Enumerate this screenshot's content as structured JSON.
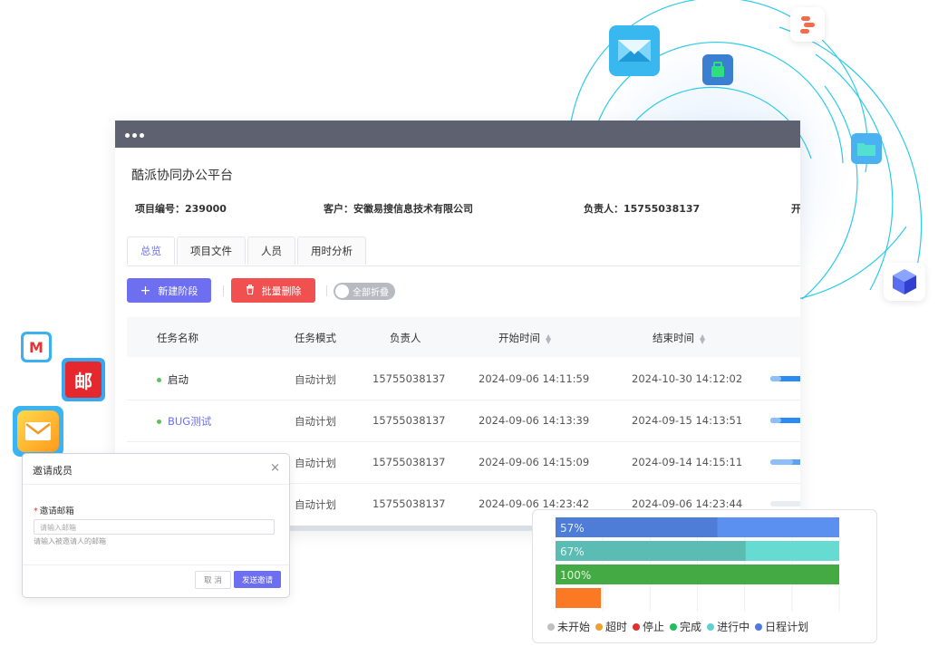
{
  "window": {
    "app_title": "酷派协同办公平台",
    "project_no": "项目编号：239000",
    "client": "客户：安徽易搜信息技术有限公司",
    "owner": "负责人：15755038137",
    "cut_label": "开"
  },
  "tabs": [
    {
      "label": "总览",
      "active": true
    },
    {
      "label": "项目文件",
      "active": false
    },
    {
      "label": "人员",
      "active": false
    },
    {
      "label": "用时分析",
      "active": false
    }
  ],
  "toolbar": {
    "add_stage": "新建阶段",
    "batch_delete": "批量删除",
    "collapse_all": "全部折叠"
  },
  "table": {
    "columns": [
      "任务名称",
      "任务模式",
      "负责人",
      "开始时间",
      "结束时间"
    ],
    "rows": [
      {
        "name": "启动",
        "mode": "自动计划",
        "owner": "15755038137",
        "start": "2024-09-06 14:11:59",
        "end": "2024-10-30 14:12:02"
      },
      {
        "name": "BUG测试",
        "mode": "自动计划",
        "owner": "15755038137",
        "start": "2024-09-06 14:13:39",
        "end": "2024-09-15 14:13:51"
      },
      {
        "name": "",
        "mode": "自动计划",
        "owner": "15755038137",
        "start": "2024-09-06 14:15:09",
        "end": "2024-09-14 14:15:11"
      },
      {
        "name": "",
        "mode": "自动计划",
        "owner": "15755038137",
        "start": "2024-09-06 14:23:42",
        "end": "2024-09-06 14:23:44"
      }
    ]
  },
  "dialog": {
    "title": "邀请成员",
    "close": "×",
    "field_label": "邀请邮箱",
    "required_mark": "*",
    "placeholder": "请输入邮箱",
    "hint": "请输入被邀请人的邮箱",
    "cancel": "取 消",
    "send": "发送邀请"
  },
  "chart_data": {
    "type": "bar",
    "orientation": "horizontal",
    "bars": [
      {
        "label": "57%",
        "progress": 0.57,
        "fill_color": "#4d7dd6",
        "track_color": "#5b8ff0"
      },
      {
        "label": "67%",
        "progress": 0.67,
        "fill_color": "#5bbcb3",
        "track_color": "#66dbd2"
      },
      {
        "label": "100%",
        "progress": 1.0,
        "fill_color": "#44ab44",
        "track_color": "#44ab44"
      },
      {
        "label": "",
        "progress": 0.16,
        "fill_color": "#fb7825",
        "track_color": "none"
      }
    ],
    "legend": [
      {
        "label": "未开始",
        "color": "#c0c0c0"
      },
      {
        "label": "超时",
        "color": "#f0a030"
      },
      {
        "label": "停止",
        "color": "#e03030"
      },
      {
        "label": "完成",
        "color": "#20c060"
      },
      {
        "label": "进行中",
        "color": "#60d0d0"
      },
      {
        "label": "日程计划",
        "color": "#5078e0"
      }
    ],
    "grid": true
  },
  "icons": {
    "mail_blue": "mail-icon",
    "bag_green": "bag-icon",
    "tool_orange": "connector-icon",
    "folder_teal": "folder-icon",
    "cube_blue": "cube-icon",
    "gmail_red": "gmail-icon",
    "post_red": "post-office-icon",
    "mail_yellow": "mail-envelope-icon"
  },
  "colors": {
    "accent": "#6e6ef0",
    "danger": "#f05050",
    "titlebar": "#5e6170",
    "orbit": "#2ccbe8"
  }
}
